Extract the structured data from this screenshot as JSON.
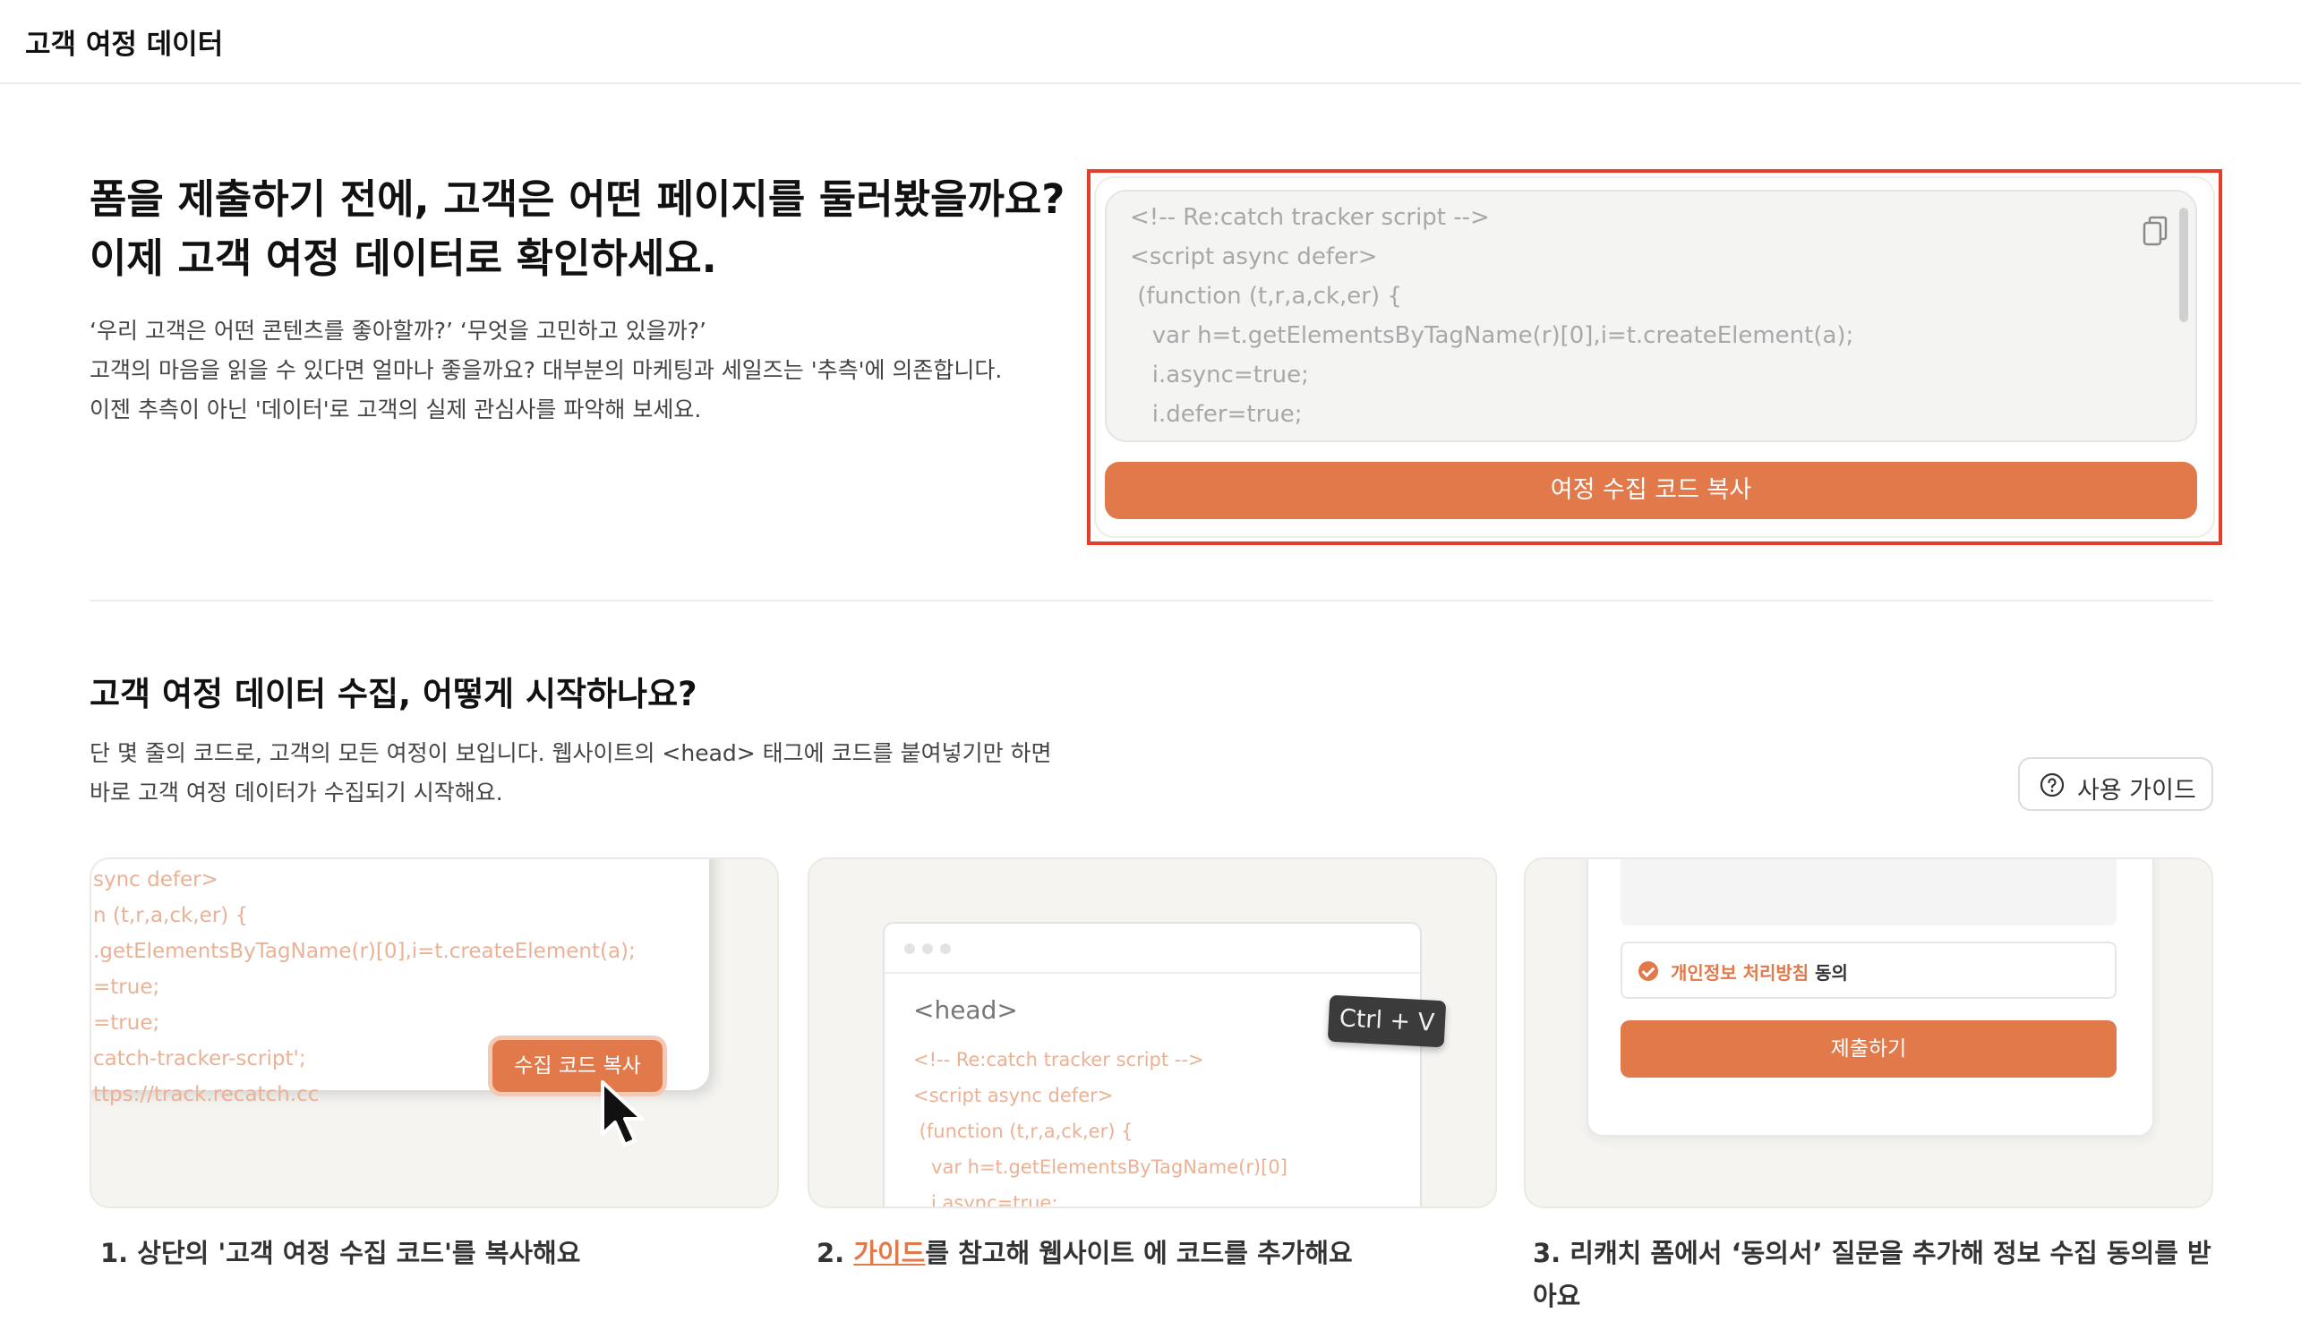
{
  "header": {
    "title": "고객 여정 데이터"
  },
  "hero": {
    "heading_line1": "폼을 제출하기 전에, 고객은 어떤 페이지를 둘러봤을까요?",
    "heading_line2": "이제 고객 여정 데이터로 확인하세요.",
    "desc_line1": "‘우리 고객은 어떤 콘텐츠를 좋아할까?’ ‘무엇을 고민하고 있을까?’",
    "desc_line2": "고객의 마음을 읽을 수 있다면 얼마나 좋을까요? 대부분의 마케팅과 세일즈는 '추측'에 의존합니다.",
    "desc_line3": "이젠 추측이 아닌 '데이터'로 고객의 실제 관심사를 파악해 보세요."
  },
  "code_panel": {
    "lines": [
      "<!-- Re:catch tracker script -->",
      "<script async defer>",
      " (function (t,r,a,ck,er) {",
      "   var h=t.getElementsByTagName(r)[0],i=t.createElement(a);",
      "   i.async=true;",
      "   i.defer=true;"
    ],
    "copy_icon": "copy-icon",
    "copy_button_label": "여정 수집 코드 복사"
  },
  "section": {
    "heading": "고객 여정 데이터 수집, 어떻게 시작하나요?",
    "desc_line1": "단 몇 줄의 코드로, 고객의 모든 여정이 보입니다. 웹사이트의 <head> 태그에 코드를 붙여넣기만 하면",
    "desc_line2": "바로 고객 여정 데이터가 수집되기 시작해요.",
    "guide_button_label": "사용 가이드",
    "guide_icon": "question-circle-icon"
  },
  "steps": [
    {
      "caption": "1. 상단의 '고객 여정 수집 코드'를 복사해요",
      "code_lines": [
        "sync defer>",
        "n (t,r,a,ck,er) {",
        ".getElementsByTagName(r)[0],i=t.createElement(a);",
        "=true;",
        "=true;",
        "catch-tracker-script';",
        "ttps://track.recatch.cc"
      ],
      "button_label": "수집 코드 복사"
    },
    {
      "caption_num": "2. ",
      "caption_link": "가이드",
      "caption_rest": "를 참고해 웹사이트 에 코드를 추가해요",
      "head_tag": "<head>",
      "code_lines": [
        "<!-- Re:catch tracker script -->",
        "<script async defer>",
        " (function (t,r,a,ck,er) {",
        "   var h=t.getElementsByTagName(r)[0]",
        "   i.async=true;"
      ],
      "shortcut": "Ctrl + V"
    },
    {
      "caption_line1": "3. 리캐치 폼에서 ‘동의서’ 질문을 추가해 정보 수집 동의를 받",
      "caption_line2": "아요",
      "consent_link": "개인정보 처리방침",
      "consent_rest": " 동의",
      "submit_label": "제출하기"
    }
  ],
  "colors": {
    "accent": "#e1794a",
    "highlight": "#e43d2b"
  }
}
